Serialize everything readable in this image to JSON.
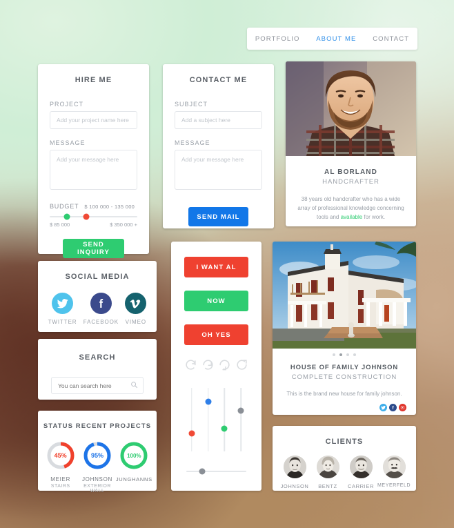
{
  "nav": {
    "items": [
      {
        "label": "PORTFOLIO",
        "active": false
      },
      {
        "label": "ABOUT ME",
        "active": true
      },
      {
        "label": "CONTACT",
        "active": false
      }
    ],
    "active_color": "#2f8fe8"
  },
  "hire_me": {
    "title": "HIRE ME",
    "project_label": "PROJECT",
    "project_placeholder": "Add your project name here",
    "project_value": "",
    "message_label": "MESSAGE",
    "message_placeholder": "Add your message here",
    "message_value": "",
    "budget_label": "BUDGET",
    "budget_value": "$ 100 000 - 135 000",
    "budget_min_label": "$ 85 000",
    "budget_max_label": "$ 350 000 +",
    "budget_handle_low_pct": 20,
    "budget_handle_high_pct": 42,
    "submit_label": "SEND INQUIRY",
    "submit_color": "#2ecc71"
  },
  "contact_me": {
    "title": "CONTACT ME",
    "subject_label": "SUBJECT",
    "subject_placeholder": "Add a subject here",
    "subject_value": "",
    "message_label": "MESSAGE",
    "message_placeholder": "Add your message here",
    "message_value": "",
    "submit_label": "SEND MAIL",
    "submit_color": "#1277e8"
  },
  "profile": {
    "photo_alt": "portrait-photo",
    "name": "AL BORLAND",
    "role": "HANDCRAFTER",
    "bio_part1": "38 years old handcrafter who has a wide array of professional knowledge concerning tools and ",
    "bio_highlight": "available",
    "bio_part2": " for work.",
    "highlight_color": "#2ecc71"
  },
  "social_media": {
    "title": "SOCIAL MEDIA",
    "items": [
      {
        "name": "TWITTER",
        "icon": "twitter-icon",
        "color": "#4fc3ec"
      },
      {
        "name": "FACEBOOK",
        "icon": "facebook-icon",
        "color": "#3b4a8c"
      },
      {
        "name": "VIMEO",
        "icon": "vimeo-icon",
        "color": "#15626e"
      }
    ]
  },
  "search": {
    "title": "SEARCH",
    "placeholder": "You can search here",
    "value": "",
    "icon": "magnifier-icon"
  },
  "status": {
    "title": "STATUS RECENT PROJECTS",
    "items": [
      {
        "name": "MEIER",
        "sub": "STAIRS",
        "percent": 45,
        "label": "45%",
        "color": "#f0412c"
      },
      {
        "name": "JOHNSON",
        "sub": "EXTERIOR WALL",
        "percent": 95,
        "label": "95%",
        "color": "#1d74e8"
      },
      {
        "name": "JUNGHANNS",
        "sub": "",
        "percent": 100,
        "label": "100%",
        "color": "#2ecc71"
      }
    ],
    "track_color": "#d8dbdf"
  },
  "widgets": {
    "buttons": [
      {
        "label": "I WANT AL",
        "color": "#ef4130"
      },
      {
        "label": "NOW",
        "color": "#2ecc71"
      },
      {
        "label": "OH YES",
        "color": "#ef4130"
      }
    ],
    "spinners": [
      "refresh-icon-1",
      "refresh-icon-2",
      "refresh-icon-3",
      "refresh-icon-4"
    ],
    "vertical_sliders": [
      {
        "name": "slider-red",
        "color": "#f0412c",
        "position_pct": 72
      },
      {
        "name": "slider-blue",
        "color": "#2f7fe8",
        "position_pct": 22
      },
      {
        "name": "slider-green",
        "color": "#2ecc71",
        "position_pct": 64
      },
      {
        "name": "slider-gray",
        "color": "#80858c",
        "position_pct": 36
      }
    ],
    "horizontal_slider": {
      "name": "slider-gray-horizontal",
      "color": "#80858c",
      "position_pct": 26
    }
  },
  "project": {
    "photo_alt": "house-photo",
    "carousel_dots": 4,
    "carousel_active_index": 1,
    "title": "HOUSE OF FAMILY JOHNSON",
    "subtitle": "COMPLETE CONSTRUCTION",
    "description": "This is the brand new house for family johnson.",
    "share": [
      {
        "icon": "twitter-icon",
        "color": "#3eaeea"
      },
      {
        "icon": "facebook-icon",
        "color": "#2b4a8b"
      },
      {
        "icon": "youtube-icon",
        "color": "#e0342b"
      }
    ]
  },
  "clients": {
    "title": "CLIENTS",
    "items": [
      {
        "name": "JOHNSON",
        "avatar": "client-avatar-johnson"
      },
      {
        "name": "BENTZ",
        "avatar": "client-avatar-bentz"
      },
      {
        "name": "CARRIER",
        "avatar": "client-avatar-carrier"
      },
      {
        "name": "MEYERFELD",
        "avatar": "client-avatar-meyerfeld"
      }
    ]
  }
}
